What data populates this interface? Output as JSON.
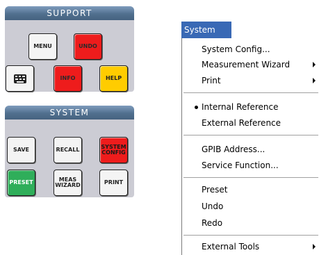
{
  "support_panel": {
    "header": "SUPPORT",
    "keys": {
      "menu": "MENU",
      "undo": "UNDO",
      "info": "INFO",
      "help": "HELP"
    }
  },
  "system_panel": {
    "header": "SYSTEM",
    "keys": {
      "save": "SAVE",
      "recall": "RECALL",
      "system_config": "SYSTEM\nCONFIG",
      "preset": "PRESET",
      "meas_wizard": "MEAS\nWIZARD",
      "print": "PRINT"
    }
  },
  "colors": {
    "panel_bg": "#ccccd4",
    "header_blue": "#51708f",
    "key_red": "#ee1c1c",
    "key_yellow": "#ffcc00",
    "key_green": "#2fae5a",
    "menu_title_bg": "#3969b5"
  },
  "menu": {
    "title": "System",
    "items": {
      "system_config": "System Config...",
      "measurement_wizard": "Measurement Wizard",
      "print": "Print",
      "internal_reference": "Internal Reference",
      "external_reference": "External Reference",
      "gpib_address": "GPIB Address...",
      "service_function": "Service Function...",
      "preset": "Preset",
      "undo": "Undo",
      "redo": "Redo",
      "external_tools": "External Tools"
    },
    "checked_item": "Internal Reference"
  }
}
